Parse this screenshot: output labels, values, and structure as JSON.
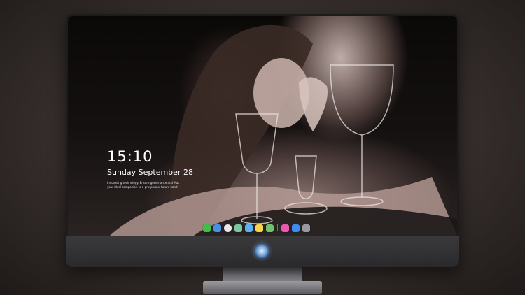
{
  "lockscreen": {
    "time": "15:10",
    "date": "Sunday September 28",
    "note_line_1": "Innovating technology. Ensure governance and Mac",
    "note_line_2": "your ideal companion to a prosperous future hand"
  },
  "dock": {
    "items": [
      {
        "name": "messages-icon",
        "color": "#3fbf4a"
      },
      {
        "name": "finder-icon",
        "color": "#4a90e2"
      },
      {
        "name": "clock-icon",
        "color": "#e8e8e8"
      },
      {
        "name": "maps-icon",
        "color": "#7cc4a4"
      },
      {
        "name": "clapper-icon",
        "color": "#5ab0f0"
      },
      {
        "name": "notes-icon",
        "color": "#f6d34a"
      },
      {
        "name": "photos-icon",
        "color": "#6fc06f"
      },
      {
        "name": "music-icon",
        "color": "#e857b0"
      },
      {
        "name": "app-store-icon",
        "color": "#3b8df0"
      },
      {
        "name": "camera-icon",
        "color": "#9a9a9e"
      }
    ]
  },
  "colors": {
    "bezel": "#1c1b1d",
    "chin": "#3a3a3d",
    "lock_text": "#ffffff"
  }
}
